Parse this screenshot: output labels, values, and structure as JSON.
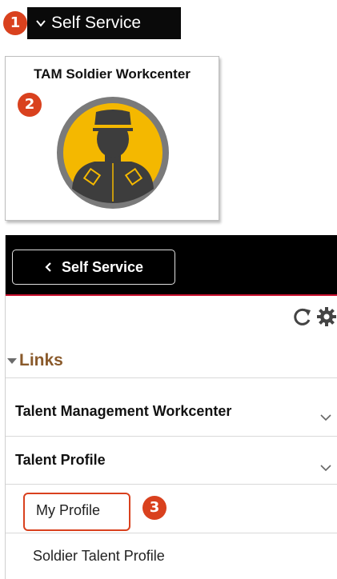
{
  "badges": {
    "step1": "1",
    "step2": "2",
    "step3": "3"
  },
  "header_snippet": {
    "label": "Self Service",
    "icon": "chevron-down-icon"
  },
  "tile": {
    "title": "TAM Soldier Workcenter",
    "icon": "soldier-avatar-icon"
  },
  "nav": {
    "back_label": "Self Service",
    "back_icon": "chevron-left-icon",
    "toolbar": [
      "refresh-icon",
      "gear-icon"
    ],
    "links_heading": "Links",
    "groups": [
      {
        "label": "Talent Management Workcenter",
        "expanded": false
      },
      {
        "label": "Talent Profile",
        "expanded": true
      }
    ],
    "items": [
      {
        "label": "My Profile",
        "highlighted": true
      },
      {
        "label": "Soldier Talent Profile",
        "highlighted": false
      }
    ]
  },
  "colors": {
    "badge": "#d9411e",
    "header_bg": "#000000",
    "header_accent": "#c8102e",
    "tile_icon_ring": "#7a7a7a",
    "tile_icon_fill": "#f4b800",
    "soldier": "#3d3d3d",
    "links_heading": "#8a5a2b"
  }
}
